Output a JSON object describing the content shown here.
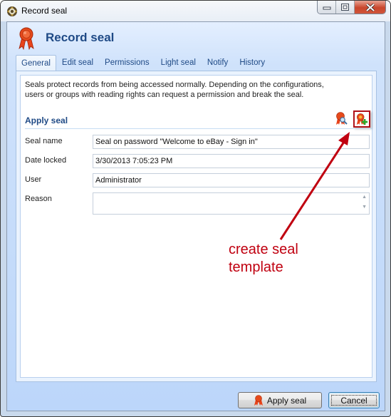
{
  "window": {
    "title": "Record seal",
    "controls": {
      "minimize": "minimize",
      "maximize": "maximize",
      "close": "close"
    }
  },
  "header": {
    "title": "Record seal",
    "icon": "seal-ribbon-icon"
  },
  "tabs": [
    {
      "label": "General",
      "active": true
    },
    {
      "label": "Edit seal",
      "active": false
    },
    {
      "label": "Permissions",
      "active": false
    },
    {
      "label": "Light seal",
      "active": false
    },
    {
      "label": "Notify",
      "active": false
    },
    {
      "label": "History",
      "active": false
    }
  ],
  "general": {
    "description_line1": "Seals protect records from being accessed normally. Depending on the configurations,",
    "description_line2": "users or groups with reading rights can request a permission and break the seal.",
    "section_title": "Apply seal",
    "section_icons": [
      "view-seal-icon",
      "create-seal-template-icon"
    ],
    "fields": {
      "seal_name": {
        "label": "Seal name",
        "value": "Seal on password \"Welcome to eBay - Sign in\""
      },
      "date_locked": {
        "label": "Date locked",
        "value": "3/30/2013 7:05:23 PM"
      },
      "user": {
        "label": "User",
        "value": "Administrator"
      },
      "reason": {
        "label": "Reason",
        "value": ""
      }
    }
  },
  "annotation": {
    "line1": "create seal",
    "line2": "template",
    "color": "#c00010"
  },
  "footer": {
    "apply_label": "Apply seal",
    "cancel_label": "Cancel"
  },
  "colors": {
    "accent_text": "#1f4a86",
    "highlight_border": "#b0121a"
  }
}
